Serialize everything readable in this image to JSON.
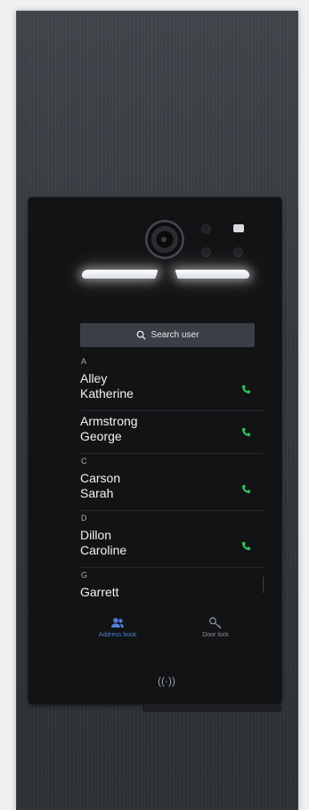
{
  "search": {
    "label": "Search user"
  },
  "contacts": [
    {
      "letter": "A"
    },
    {
      "line1": "Alley",
      "line2": "Katherine"
    },
    {
      "line1": "Armstrong",
      "line2": "George"
    },
    {
      "letter": "C"
    },
    {
      "line1": "Carson",
      "line2": "Sarah"
    },
    {
      "letter": "D"
    },
    {
      "line1": "Dillon",
      "line2": "Caroline"
    },
    {
      "letter": "G"
    },
    {
      "line1": "Garrett",
      "line2": ""
    }
  ],
  "nav": {
    "address_book": "Address book",
    "door_lock": "Door lock"
  },
  "nfc": {
    "symbol": "((·))"
  },
  "colors": {
    "accent_blue": "#4d7fd6",
    "call_green": "#2fbf5b",
    "led_white": "#ffffff"
  },
  "icons": [
    "search-icon",
    "phone-icon",
    "contacts-icon",
    "key-icon",
    "nfc-icon",
    "camera-icon"
  ]
}
